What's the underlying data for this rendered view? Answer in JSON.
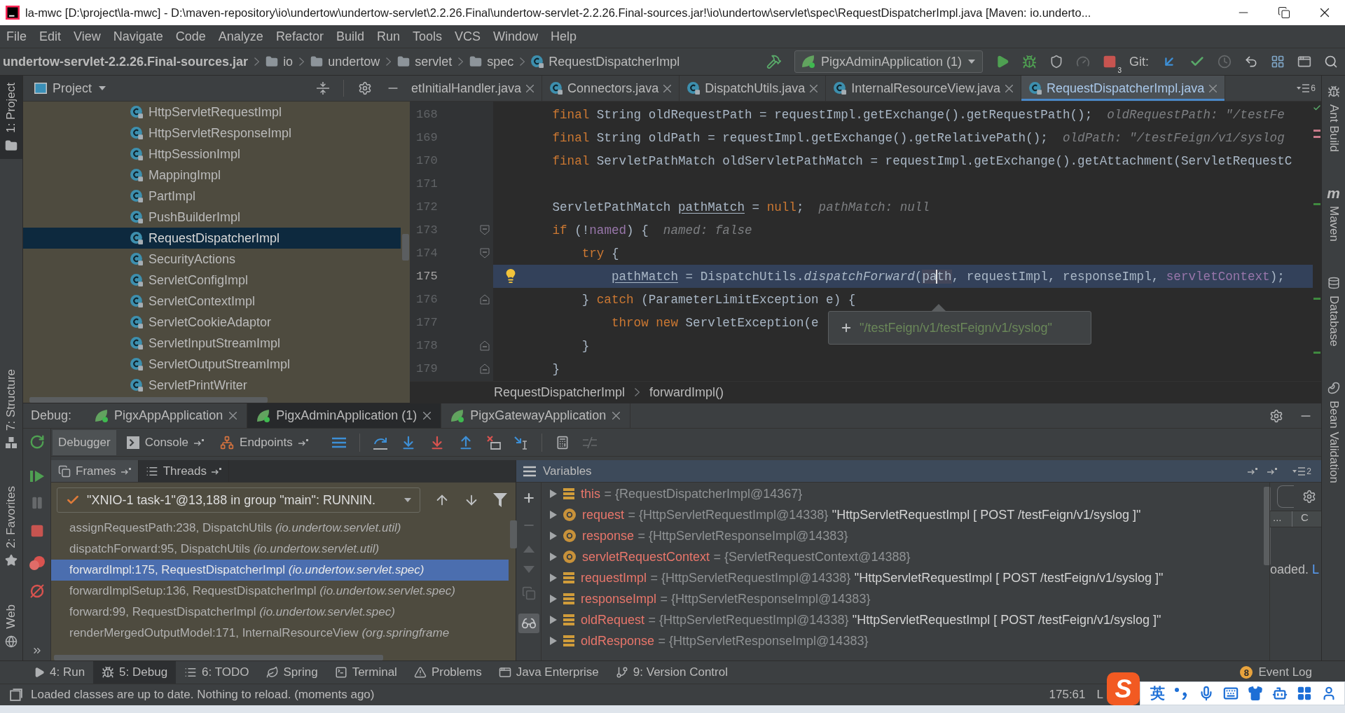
{
  "window": {
    "title": "la-mwc [D:\\project\\la-mwc] - D:\\maven-repository\\io\\undertow\\undertow-servlet\\2.2.26.Final\\undertow-servlet-2.2.26.Final-sources.jar!\\io\\undertow\\servlet\\spec\\RequestDispatcherImpl.java [Maven: io.underto..."
  },
  "menu": [
    "File",
    "Edit",
    "View",
    "Navigate",
    "Code",
    "Analyze",
    "Refactor",
    "Build",
    "Run",
    "Tools",
    "VCS",
    "Window",
    "Help"
  ],
  "navbar": {
    "breadcrumbs": [
      {
        "label": "undertow-servlet-2.2.26.Final-sources.jar",
        "kind": "jar"
      },
      {
        "label": "io",
        "kind": "folder"
      },
      {
        "label": "undertow",
        "kind": "folder"
      },
      {
        "label": "servlet",
        "kind": "folder"
      },
      {
        "label": "spec",
        "kind": "folder"
      },
      {
        "label": "RequestDispatcherImpl",
        "kind": "class"
      }
    ],
    "run_config": "PigxAdminApplication (1)",
    "stop_badge": "3",
    "git_label": "Git:"
  },
  "left_strip": [
    {
      "label": "1: Project",
      "kind": "project",
      "selected": true
    },
    {
      "label": "7: Structure",
      "kind": "structure",
      "selected": false
    },
    {
      "label": "2: Favorites",
      "kind": "favorites",
      "selected": false
    },
    {
      "label": "Web",
      "kind": "web",
      "selected": false
    }
  ],
  "right_strip": [
    {
      "label": "Ant Build",
      "kind": "ant"
    },
    {
      "label": "Maven",
      "kind": "maven",
      "icon_text": "m"
    },
    {
      "label": "Database",
      "kind": "database"
    },
    {
      "label": "Bean Validation",
      "kind": "bean"
    }
  ],
  "project": {
    "title": "Project",
    "items": [
      {
        "label": "HttpServletRequestImpl",
        "selected": false
      },
      {
        "label": "HttpServletResponseImpl",
        "selected": false
      },
      {
        "label": "HttpSessionImpl",
        "selected": false
      },
      {
        "label": "MappingImpl",
        "selected": false
      },
      {
        "label": "PartImpl",
        "selected": false
      },
      {
        "label": "PushBuilderImpl",
        "selected": false
      },
      {
        "label": "RequestDispatcherImpl",
        "selected": true
      },
      {
        "label": "SecurityActions",
        "selected": false
      },
      {
        "label": "ServletConfigImpl",
        "selected": false
      },
      {
        "label": "ServletContextImpl",
        "selected": false
      },
      {
        "label": "ServletCookieAdaptor",
        "selected": false
      },
      {
        "label": "ServletInputStreamImpl",
        "selected": false
      },
      {
        "label": "ServletOutputStreamImpl",
        "selected": false
      },
      {
        "label": "ServletPrintWriter",
        "selected": false
      }
    ]
  },
  "editor": {
    "tabs": [
      {
        "label": "etInitialHandler.java",
        "kind": "cut",
        "selected": false
      },
      {
        "label": "Connectors.java",
        "kind": "class",
        "selected": false
      },
      {
        "label": "DispatchUtils.java",
        "kind": "class",
        "selected": false
      },
      {
        "label": "InternalResourceView.java",
        "kind": "class",
        "selected": false
      },
      {
        "label": "RequestDispatcherImpl.java",
        "kind": "class",
        "selected": true
      }
    ],
    "tab_count": "6",
    "lines": [
      {
        "number": "168",
        "kind": "plain",
        "current": false,
        "code": [
          {
            "text": "        final",
            "kind": "keyword"
          },
          {
            "text": " String oldRequestPath = requestImpl.getExchange().getRequestPath();",
            "kind": "plain"
          }
        ],
        "hint": "oldRequestPath: \"/testFe"
      },
      {
        "number": "169",
        "kind": "plain",
        "current": false,
        "code": [
          {
            "text": "        final",
            "kind": "keyword"
          },
          {
            "text": " String oldPath = requestImpl.getExchange().getRelativePath();",
            "kind": "plain"
          }
        ],
        "hint": "oldPath: \"/testFeign/v1/syslog"
      },
      {
        "number": "170",
        "kind": "plain",
        "current": false,
        "code": [
          {
            "text": "        final",
            "kind": "keyword"
          },
          {
            "text": " ServletPathMatch oldServletPathMatch = requestImpl.getExchange().getAttachment(ServletRequestC",
            "kind": "plain"
          }
        ]
      },
      {
        "number": "171",
        "kind": "plain",
        "current": false
      },
      {
        "number": "172",
        "kind": "plain",
        "current": false,
        "code": [
          {
            "text": "        ServletPathMatch ",
            "kind": "plain"
          },
          {
            "text": "pathMatch",
            "kind": "reassigned"
          },
          {
            "text": " = ",
            "kind": "plain"
          },
          {
            "text": "null",
            "kind": "keyword"
          },
          {
            "text": ";",
            "kind": "plain"
          }
        ],
        "hint": "pathMatch: null"
      },
      {
        "number": "173",
        "kind": "open",
        "current": false,
        "code": [
          {
            "text": "        if",
            "kind": "keyword"
          },
          {
            "text": " (!",
            "kind": "plain"
          },
          {
            "text": "named",
            "kind": "field"
          },
          {
            "text": ") {",
            "kind": "plain"
          }
        ],
        "hint": "named: false"
      },
      {
        "number": "174",
        "kind": "open",
        "current": false,
        "code": [
          {
            "text": "            try",
            "kind": "keyword"
          },
          {
            "text": " {",
            "kind": "plain"
          }
        ]
      },
      {
        "number": "175",
        "kind": "plain",
        "current": true,
        "bulb": true,
        "code": [
          {
            "text": "                pathMatch",
            "kind": "reassigned"
          },
          {
            "text": " = DispatchUtils.",
            "kind": "plain"
          },
          {
            "text": "dispatchForward",
            "kind": "static"
          },
          {
            "text": "(",
            "kind": "plain"
          },
          {
            "text": "path",
            "kind": "caret"
          },
          {
            "text": ", requestImpl, responseImpl, ",
            "kind": "plain"
          },
          {
            "text": "servletContext",
            "kind": "field"
          },
          {
            "text": ");",
            "kind": "plain"
          }
        ]
      },
      {
        "number": "176",
        "kind": "close",
        "current": false,
        "code": [
          {
            "text": "            } ",
            "kind": "plain"
          },
          {
            "text": "catch",
            "kind": "keyword"
          },
          {
            "text": " (ParameterLimitException e) {",
            "kind": "plain"
          }
        ]
      },
      {
        "number": "177",
        "kind": "plain",
        "current": false,
        "code": [
          {
            "text": "                throw",
            "kind": "keyword"
          },
          {
            "text": " new",
            "kind": "keyword"
          },
          {
            "text": " ServletException(e",
            "kind": "plain"
          }
        ]
      },
      {
        "number": "178",
        "kind": "close",
        "current": false,
        "code": [
          {
            "text": "            }",
            "kind": "plain"
          }
        ]
      },
      {
        "number": "179",
        "kind": "close",
        "current": false,
        "code": [
          {
            "text": "        }",
            "kind": "plain"
          }
        ]
      }
    ],
    "tooltip": "\"/testFeign/v1/testFeign/v1/syslog\"",
    "breadcrumbs": [
      "RequestDispatcherImpl",
      "forwardImpl()"
    ]
  },
  "debug": {
    "label": "Debug:",
    "sessions": [
      {
        "label": "PigxAppApplication",
        "selected": false
      },
      {
        "label": "PigxAdminApplication (1)",
        "selected": true
      },
      {
        "label": "PigxGatewayApplication",
        "selected": false
      }
    ],
    "tabs": [
      {
        "label": "Debugger",
        "kind": "debugger",
        "selected": true
      },
      {
        "label": "Console",
        "kind": "console",
        "selected": false
      },
      {
        "label": "Endpoints",
        "kind": "endpoints",
        "selected": false
      }
    ],
    "frames_tabs": [
      {
        "label": "Frames",
        "kind": "frames",
        "selected": true
      },
      {
        "label": "Threads",
        "kind": "threads",
        "selected": false
      }
    ],
    "thread": "\"XNIO-1 task-1\"@13,188 in group \"main\": RUNNIN.",
    "frames": [
      {
        "text": "assignRequestPath:238, DispatchUtils *(io.undertow.servlet.util)*",
        "selected": false
      },
      {
        "text": "dispatchForward:95, DispatchUtils *(io.undertow.servlet.util)*",
        "selected": false
      },
      {
        "text": "forwardImpl:175, RequestDispatcherImpl *(io.undertow.servlet.spec)*",
        "selected": true
      },
      {
        "text": "forwardImplSetup:136, RequestDispatcherImpl *(io.undertow.servlet.spec)*",
        "selected": false
      },
      {
        "text": "forward:99, RequestDispatcherImpl *(io.undertow.servlet.spec)*",
        "selected": false
      },
      {
        "text": "renderMergedOutputModel:171, InternalResourceView *(org.springframe*",
        "selected": false
      }
    ],
    "variables_title": "Variables",
    "variables_count": "2",
    "watches_on": true,
    "variables": [
      {
        "name": "this",
        "value": "= {RequestDispatcherImpl@14367}",
        "kind": "field",
        "expanded": false
      },
      {
        "name": "request",
        "value": "= {HttpServletRequestImpl@14338}",
        "string": "\"HttpServletRequestImpl [ POST /testFeign/v1/syslog ]\"",
        "kind": "param",
        "expanded": false
      },
      {
        "name": "response",
        "value": "= {HttpServletResponseImpl@14383}",
        "kind": "param",
        "expanded": false
      },
      {
        "name": "servletRequestContext",
        "value": "= {ServletRequestContext@14388}",
        "kind": "param",
        "expanded": false
      },
      {
        "name": "requestImpl",
        "value": "= {HttpServletRequestImpl@14338}",
        "string": "\"HttpServletRequestImpl [ POST /testFeign/v1/syslog ]\"",
        "kind": "field",
        "expanded": false
      },
      {
        "name": "responseImpl",
        "value": "= {HttpServletResponseImpl@14383}",
        "kind": "field",
        "expanded": false
      },
      {
        "name": "oldRequest",
        "value": "= {HttpServletRequestImpl@14338}",
        "string": "\"HttpServletRequestImpl [ POST /testFeign/v1/syslog ]\"",
        "kind": "field",
        "expanded": false
      },
      {
        "name": "oldResponse",
        "value": "= {HttpServletResponseImpl@14383}",
        "kind": "field",
        "expanded": false
      }
    ],
    "side_panel": {
      "column_1": "...",
      "column_2": "C",
      "text": "oaded. ",
      "link": "L"
    }
  },
  "bottom_bar": {
    "items": [
      {
        "label": "4: Run",
        "kind": "run",
        "selected": false
      },
      {
        "label": "5: Debug",
        "kind": "debug",
        "selected": true
      },
      {
        "label": "6: TODO",
        "kind": "todo",
        "selected": false
      },
      {
        "label": "Spring",
        "kind": "spring",
        "selected": false
      },
      {
        "label": "Terminal",
        "kind": "terminal",
        "selected": false
      },
      {
        "label": "Problems",
        "kind": "problems",
        "selected": false
      },
      {
        "label": "Java Enterprise",
        "kind": "javaee",
        "selected": false
      },
      {
        "label": "9: Version Control",
        "kind": "vcs",
        "selected": false
      }
    ],
    "event_log": {
      "badge": "8",
      "label": "Event Log"
    }
  },
  "status_bar": {
    "message": "Loaded classes are up to date. Nothing to reload. (moments ago)",
    "position": "175:61",
    "line_separator": "L"
  },
  "ime": {
    "logo": "S",
    "mode": "英"
  }
}
